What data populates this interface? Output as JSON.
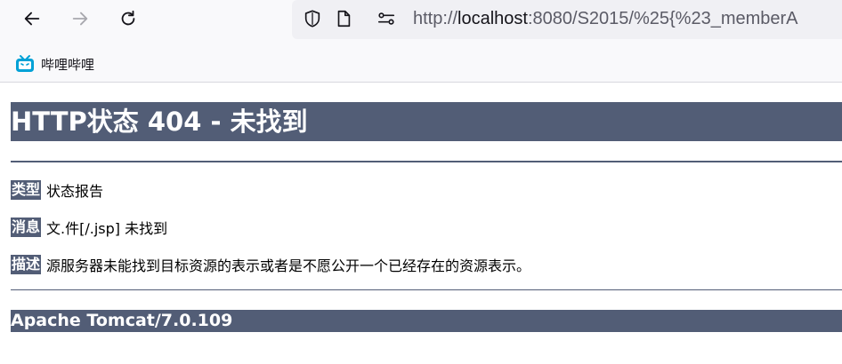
{
  "browser": {
    "url_prefix": "http://",
    "url_host": "localhost",
    "url_rest": ":8080/S2015/%25{%23_memberA",
    "bookmark_label": "哔哩哔哩",
    "icons": [
      "back-arrow-icon",
      "forward-arrow-icon",
      "reload-icon",
      "shield-icon",
      "page-icon",
      "permissions-icon",
      "bilibili-icon"
    ]
  },
  "page": {
    "title": "HTTP状态 404 - 未找到",
    "rows": [
      {
        "label": "类型",
        "value": "状态报告"
      },
      {
        "label": "消息",
        "value": "文.件[/.jsp] 未找到"
      },
      {
        "label": "描述",
        "value": "源服务器未能找到目标资源的表示或者是不愿公开一个已经存在的资源表示。"
      }
    ],
    "footer": "Apache Tomcat/7.0.109"
  },
  "colors": {
    "accent": "#525d76",
    "toolbar_bg": "#f9f9fb",
    "urlbar_bg": "#f0f0f4"
  }
}
